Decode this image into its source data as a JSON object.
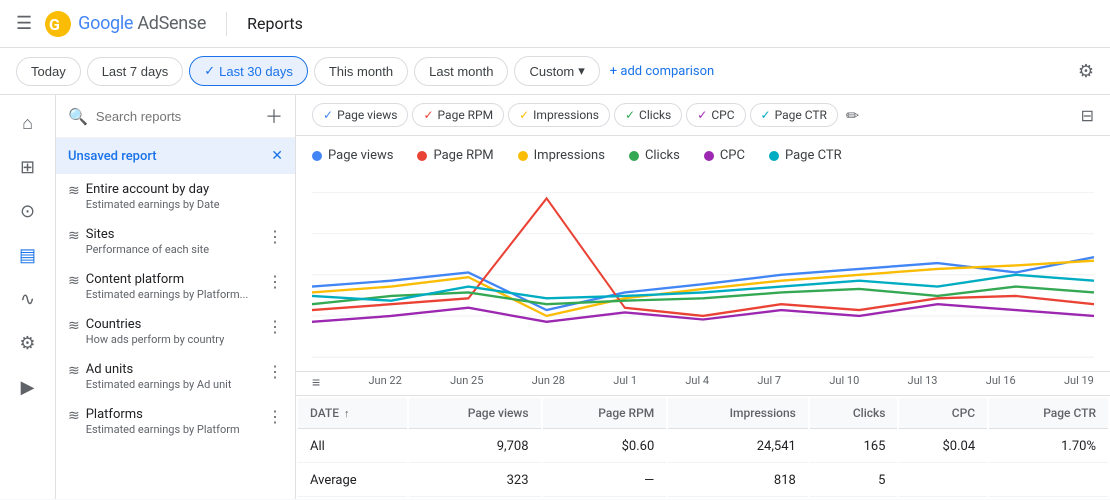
{
  "header": {
    "logo_google": "Google",
    "logo_ads": "Ad",
    "logo_sense": "Sense",
    "title": "Reports",
    "hamburger": "☰"
  },
  "filter_bar": {
    "buttons": [
      {
        "label": "Today",
        "active": false,
        "id": "today"
      },
      {
        "label": "Last 7 days",
        "active": false,
        "id": "last7"
      },
      {
        "label": "Last 30 days",
        "active": true,
        "id": "last30"
      },
      {
        "label": "This month",
        "active": false,
        "id": "thismonth"
      },
      {
        "label": "Last month",
        "active": false,
        "id": "lastmonth"
      }
    ],
    "custom_label": "Custom",
    "add_comparison_label": "+ add comparison",
    "check_icon": "✓"
  },
  "sidebar": {
    "icons": [
      {
        "name": "home-icon",
        "symbol": "⌂",
        "active": false
      },
      {
        "name": "chart-icon",
        "symbol": "⊞",
        "active": false
      },
      {
        "name": "person-icon",
        "symbol": "⊙",
        "active": false
      },
      {
        "name": "reports-icon",
        "symbol": "▤",
        "active": true
      },
      {
        "name": "trends-icon",
        "symbol": "∿",
        "active": false
      },
      {
        "name": "settings-icon",
        "symbol": "⚙",
        "active": false
      },
      {
        "name": "video-icon",
        "symbol": "▶",
        "active": false
      }
    ],
    "search_placeholder": "Search reports",
    "active_report_label": "Unsaved report",
    "items": [
      {
        "icon": "≋",
        "title": "Entire account by day",
        "desc": "Estimated earnings by Date"
      },
      {
        "icon": "≋",
        "title": "Sites",
        "desc": "Performance of each site"
      },
      {
        "icon": "≋",
        "title": "Content platform",
        "desc": "Estimated earnings by Platform..."
      },
      {
        "icon": "≋",
        "title": "Countries",
        "desc": "How ads perform by country"
      },
      {
        "icon": "≋",
        "title": "Ad units",
        "desc": "Estimated earnings by Ad unit"
      },
      {
        "icon": "≋",
        "title": "Platforms",
        "desc": "Estimated earnings by Platform"
      }
    ]
  },
  "metrics": {
    "chips": [
      {
        "label": "Page views",
        "color": "#4285f4",
        "checked": true
      },
      {
        "label": "Page RPM",
        "color": "#ea4335",
        "checked": true
      },
      {
        "label": "Impressions",
        "color": "#fbbc04",
        "checked": true
      },
      {
        "label": "Clicks",
        "color": "#34a853",
        "checked": true
      },
      {
        "label": "CPC",
        "color": "#9c27b0",
        "checked": true
      },
      {
        "label": "Page CTR",
        "color": "#00acc1",
        "checked": true
      }
    ]
  },
  "legend": [
    {
      "label": "Page views",
      "color": "#4285f4"
    },
    {
      "label": "Page RPM",
      "color": "#ea4335"
    },
    {
      "label": "Impressions",
      "color": "#fbbc04"
    },
    {
      "label": "Clicks",
      "color": "#34a853"
    },
    {
      "label": "CPC",
      "color": "#9c27b0"
    },
    {
      "label": "Page CTR",
      "color": "#00acc1"
    }
  ],
  "chart": {
    "x_labels": [
      "Jun 22",
      "Jun 25",
      "Jun 28",
      "Jul 1",
      "Jul 4",
      "Jul 7",
      "Jul 10",
      "Jul 13",
      "Jul 16",
      "Jul 19"
    ]
  },
  "table": {
    "columns": [
      "DATE",
      "Page views",
      "Page RPM",
      "Impressions",
      "Clicks",
      "CPC",
      "Page CTR"
    ],
    "rows": [
      {
        "date": "All",
        "page_views": "9,708",
        "page_rpm": "$0.60",
        "impressions": "24,541",
        "clicks": "165",
        "cpc": "$0.04",
        "page_ctr": "1.70%"
      },
      {
        "date": "Average",
        "page_views": "323",
        "page_rpm": "—",
        "impressions": "818",
        "clicks": "5",
        "cpc": "",
        "page_ctr": ""
      }
    ]
  }
}
